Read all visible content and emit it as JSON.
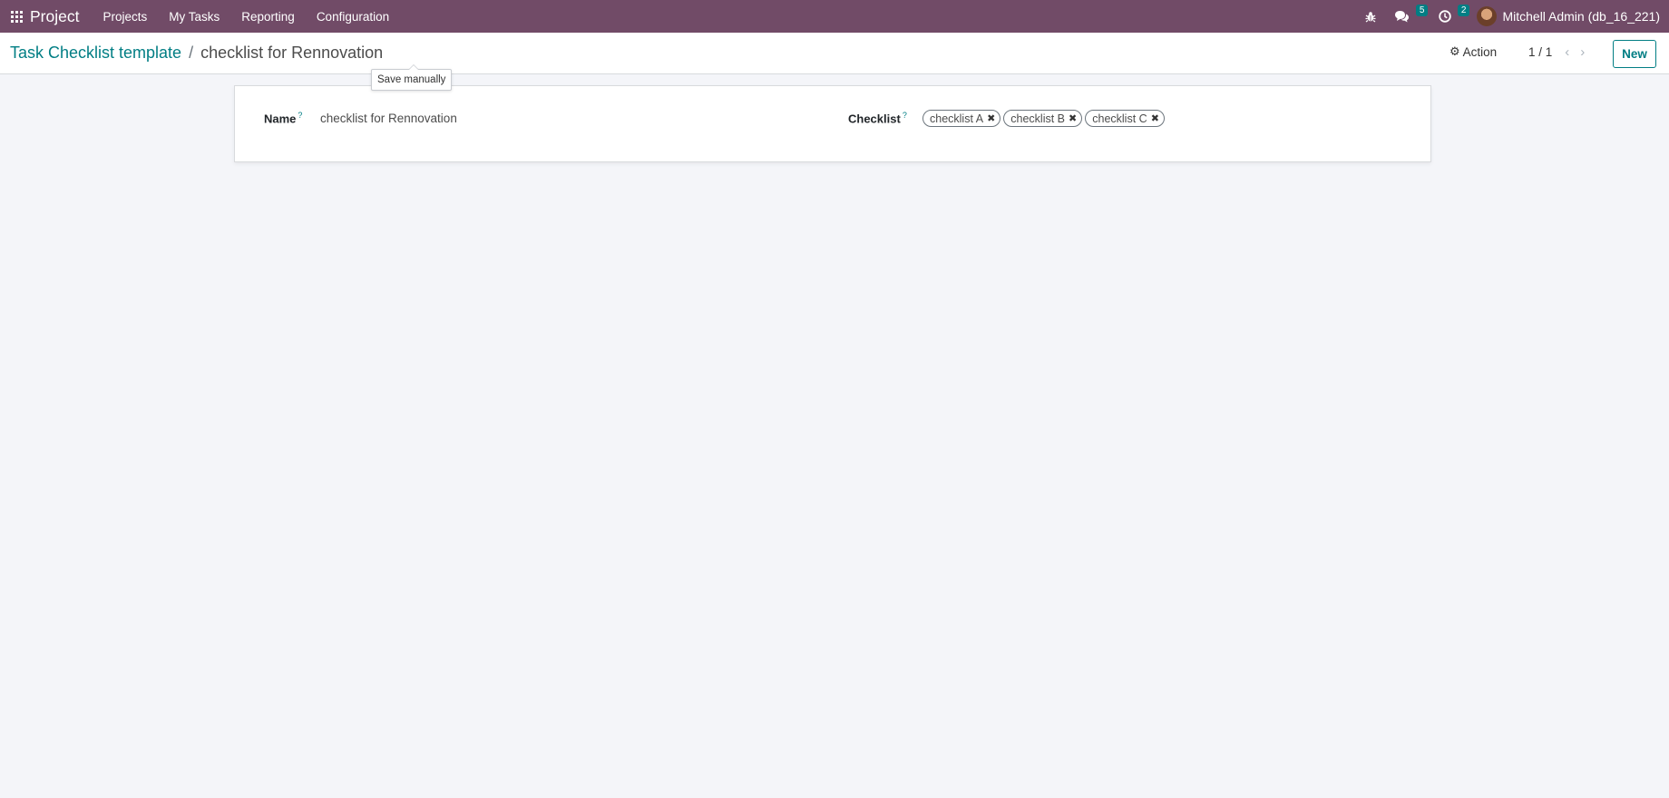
{
  "navbar": {
    "app_name": "Project",
    "menu": [
      "Projects",
      "My Tasks",
      "Reporting",
      "Configuration"
    ],
    "messages_count": "5",
    "activities_count": "2",
    "user_name": "Mitchell Admin (db_16_221)",
    "icons": {
      "apps": "apps-grid-icon",
      "debug": "bug-icon",
      "messages": "chat-bubbles-icon",
      "activities": "clock-icon"
    }
  },
  "breadcrumb": {
    "parent": "Task Checklist template",
    "separator": "/",
    "current": "checklist for Rennovation"
  },
  "tooltip": "Save manually",
  "control": {
    "action_label": "Action",
    "pager": "1 / 1",
    "new_label": "New"
  },
  "form": {
    "name_label": "Name",
    "help_mark": "?",
    "name_value": "checklist for Rennovation",
    "checklist_label": "Checklist",
    "checklist_tags": [
      "checklist A",
      "checklist B",
      "checklist C"
    ]
  },
  "colors": {
    "navbar": "#714b67",
    "accent": "#017e84",
    "background": "#f4f5f9"
  }
}
